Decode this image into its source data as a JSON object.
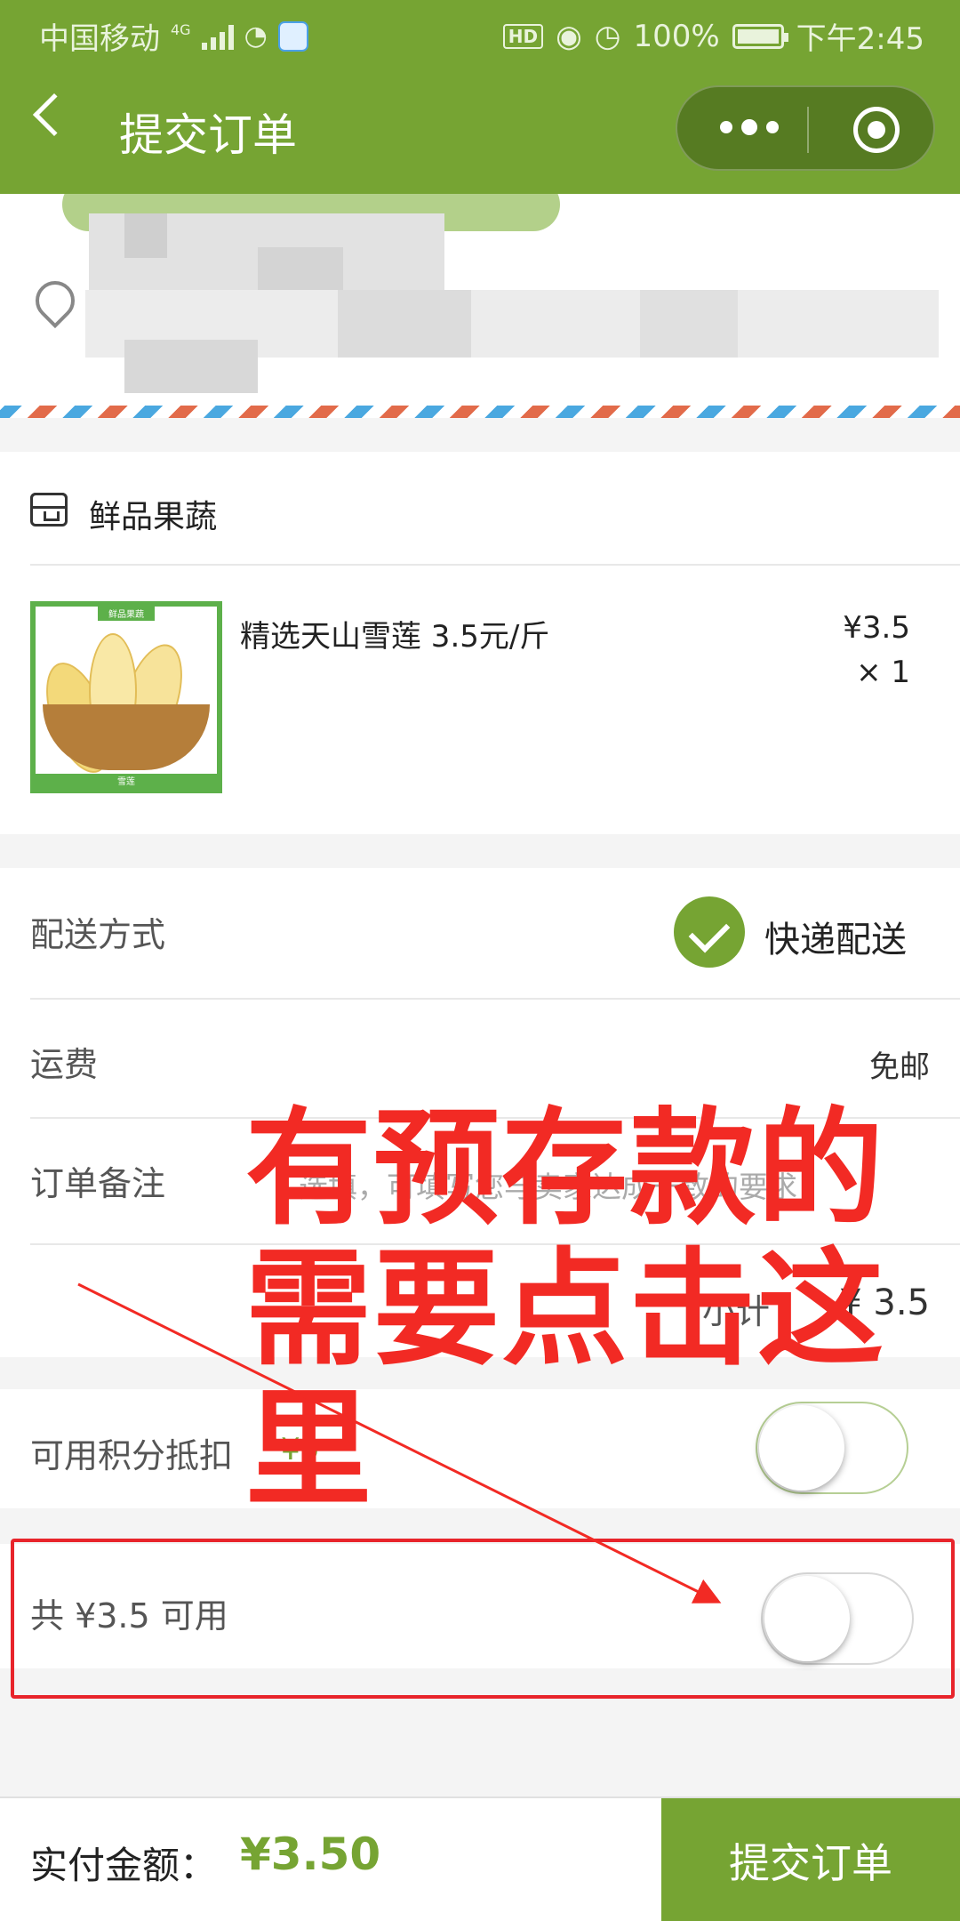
{
  "status_bar": {
    "carrier": "中国移动",
    "network": "4G",
    "battery": "100%",
    "time": "下午2:45",
    "hd_label": "HD"
  },
  "nav": {
    "title": "提交订单"
  },
  "store": {
    "name": "鲜品果蔬",
    "icon": "store-icon"
  },
  "product": {
    "name": "精选天山雪莲 3.5元/斤",
    "price": "¥3.5",
    "quantity": "× 1",
    "thumb_top_label": "鲜品果蔬",
    "thumb_bottom_label": "雪莲"
  },
  "delivery": {
    "label": "配送方式",
    "value": "快递配送"
  },
  "shipping": {
    "label": "运费",
    "value": "免邮"
  },
  "remark": {
    "label": "订单备注",
    "placeholder": "选填，可填写您与卖家达成一致的要求"
  },
  "subtotal": {
    "label": "小计",
    "value": "¥ 3.5"
  },
  "points": {
    "label": "可用积分抵扣",
    "value": "¥0"
  },
  "deposit": {
    "label": "共 ¥3.5 可用"
  },
  "annotation": {
    "text": "有预存款的需要点击这里",
    "color": "#f22a24"
  },
  "footer": {
    "label": "实付金额：",
    "amount": "¥3.50",
    "submit_label": "提交订单"
  },
  "colors": {
    "brand_green": "#76a433",
    "highlight_red": "#e8242b"
  }
}
